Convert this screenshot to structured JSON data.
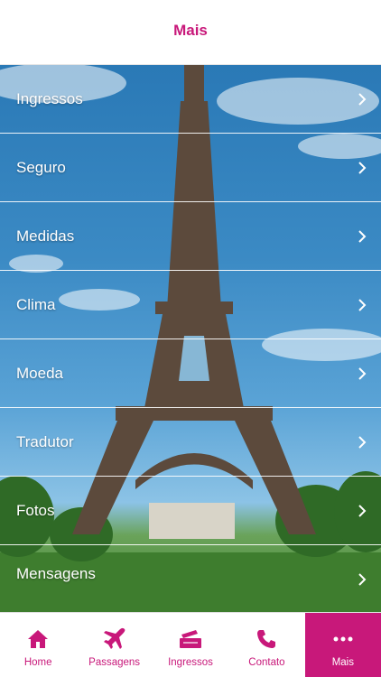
{
  "header": {
    "title": "Mais"
  },
  "menu": {
    "items": [
      {
        "label": "Ingressos"
      },
      {
        "label": "Seguro"
      },
      {
        "label": "Medidas"
      },
      {
        "label": "Clima"
      },
      {
        "label": "Moeda"
      },
      {
        "label": "Tradutor"
      },
      {
        "label": "Fotos"
      },
      {
        "label": "Mensagens"
      }
    ]
  },
  "tabbar": {
    "tabs": [
      {
        "label": "Home",
        "icon": "house-icon"
      },
      {
        "label": "Passagens",
        "icon": "airplane-icon"
      },
      {
        "label": "Ingressos",
        "icon": "tickets-icon"
      },
      {
        "label": "Contato",
        "icon": "phone-icon"
      },
      {
        "label": "Mais",
        "icon": "more-dots-icon",
        "active": true
      }
    ]
  },
  "colors": {
    "accent": "#c8187a",
    "text_on_image": "#ffffff"
  }
}
